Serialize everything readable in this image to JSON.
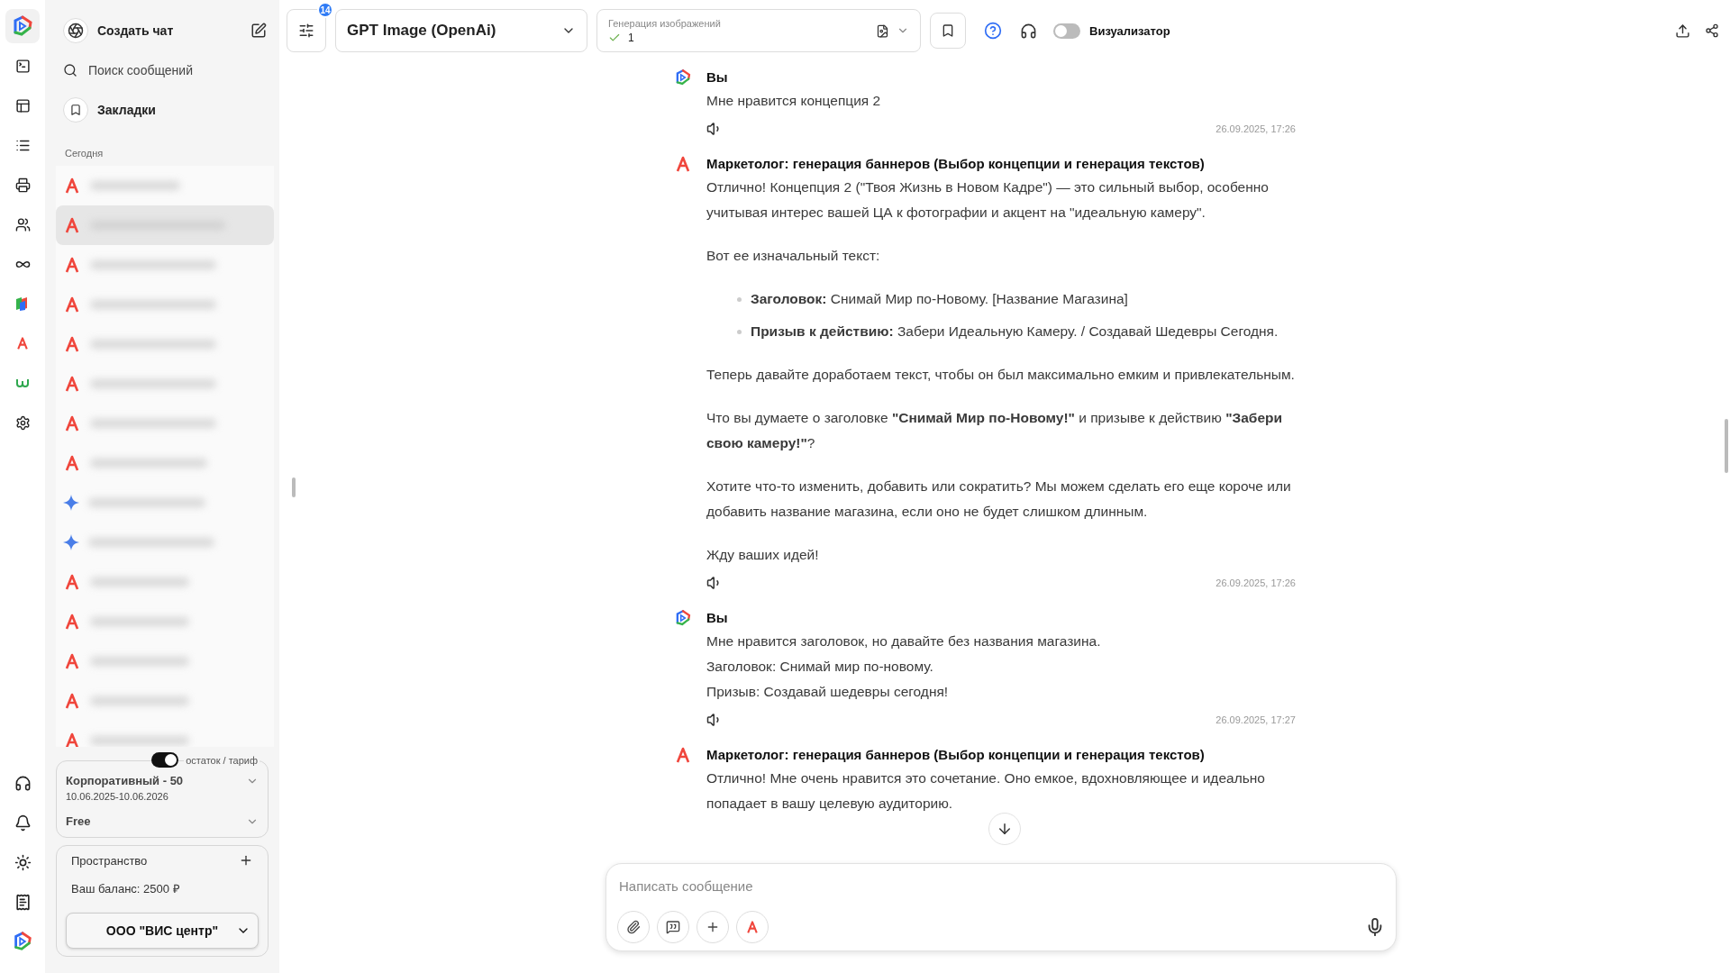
{
  "topbar": {
    "filters_badge": "14",
    "model": "GPT Image (OpenAi)",
    "generation": {
      "label": "Генерация изображений",
      "value": "1"
    },
    "visualizer": {
      "label": "Визуализатор",
      "on": false
    }
  },
  "sidebar": {
    "new_chat": "Создать чат",
    "search": {
      "placeholder": "Поиск сообщений"
    },
    "bookmarks": "Закладки",
    "section": "Сегодня",
    "chats": [
      {
        "kind": "a",
        "selected": false
      },
      {
        "kind": "a",
        "selected": true
      },
      {
        "kind": "a",
        "selected": false
      },
      {
        "kind": "a",
        "selected": false
      },
      {
        "kind": "a",
        "selected": false
      },
      {
        "kind": "a",
        "selected": false
      },
      {
        "kind": "a",
        "selected": false
      },
      {
        "kind": "a",
        "selected": false
      },
      {
        "kind": "sparkle",
        "selected": false
      },
      {
        "kind": "sparkle",
        "selected": false
      },
      {
        "kind": "a",
        "selected": false
      },
      {
        "kind": "a",
        "selected": false
      },
      {
        "kind": "a",
        "selected": false
      },
      {
        "kind": "a",
        "selected": false
      },
      {
        "kind": "a",
        "selected": false
      }
    ]
  },
  "plan": {
    "balance_toggle": {
      "label": "остаток / тариф",
      "on": true
    },
    "tariffs": [
      {
        "name": "Корпоративный - 50",
        "dates": "10.06.2025-10.06.2026"
      },
      {
        "name": "Free"
      }
    ]
  },
  "space": {
    "title": "Пространство",
    "balance": "Ваш баланс: 2500 ₽",
    "org": "ООО \"ВИС центр\""
  },
  "messages": [
    {
      "kind": "user",
      "author": "Вы",
      "time": "26.09.2025, 17:26",
      "blocks": [
        {
          "kind": "line",
          "text": "Мне нравится концепция 2"
        }
      ]
    },
    {
      "kind": "bot",
      "author": "Маркетолог: генерация баннеров (Выбор концепции и генерация текстов)",
      "time": "26.09.2025, 17:26",
      "blocks": [
        {
          "kind": "p",
          "text": "Отлично! Концепция 2 (\"Твоя Жизнь в Новом Кадре\") — это сильный выбор, особенно учитывая интерес вашей ЦА к фотографии и акцент на \"идеальную камеру\"."
        },
        {
          "kind": "p",
          "text": "Вот ее изначальный текст:"
        },
        {
          "kind": "list",
          "items": [
            "**Заголовок:** Снимай Мир по-Новому. [Название Магазина]",
            "**Призыв к действию:** Забери Идеальную Камеру. / Создавай Шедевры Сегодня."
          ]
        },
        {
          "kind": "p",
          "text": "Теперь давайте доработаем текст, чтобы он был максимально емким и привлекательным."
        },
        {
          "kind": "p",
          "text": "Что вы думаете о заголовке **\"Снимай Мир по-Новому!\"** и призыве к действию **\"Забери свою камеру!\"**?"
        },
        {
          "kind": "p",
          "text": "Хотите что-то изменить, добавить или сократить? Мы можем сделать его еще короче или добавить название магазина, если оно не будет слишком длинным."
        },
        {
          "kind": "p",
          "text": "Жду ваших идей!"
        }
      ]
    },
    {
      "kind": "user",
      "author": "Вы",
      "time": "26.09.2025, 17:27",
      "blocks": [
        {
          "kind": "line",
          "text": "Мне нравится заголовок, но давайте без названия магазина."
        },
        {
          "kind": "line",
          "text": "Заголовок: Снимай мир по-новому."
        },
        {
          "kind": "line",
          "text": "Призыв: Создавай шедевры сегодня!"
        }
      ]
    },
    {
      "kind": "bot",
      "author": "Маркетолог: генерация баннеров (Выбор концепции и генерация текстов)",
      "blocks": [
        {
          "kind": "p",
          "text": "Отлично! Мне очень нравится это сочетание. Оно емкое, вдохновляющее и идеально попадает в вашу целевую аудиторию."
        }
      ]
    }
  ],
  "composer": {
    "placeholder": "Написать сообщение"
  }
}
